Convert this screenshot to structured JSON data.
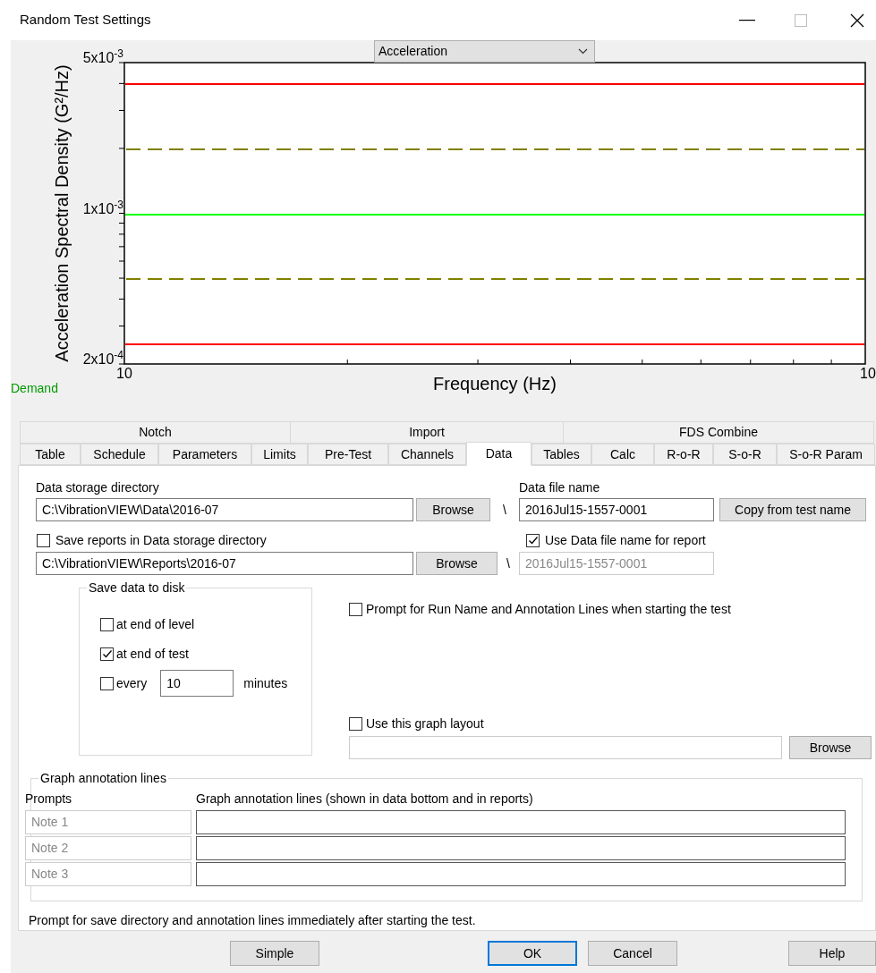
{
  "window": {
    "title": "Random Test Settings"
  },
  "chart": {
    "selector": "Acceleration",
    "ylabel": "Acceleration Spectral Density (G²/Hz)",
    "xlabel": "Frequency (Hz)",
    "y_tick_labels": [
      "5x10$^{-3}$",
      "1x10$^{-3}$",
      "2x10$^{-4}$"
    ],
    "x_tick_labels": [
      "10",
      "10"
    ],
    "lines": [
      {
        "color": "#ff0000",
        "kind": "solid"
      },
      {
        "color": "#808000",
        "kind": "dashed"
      },
      {
        "color": "#00ff00",
        "kind": "solid"
      },
      {
        "color": "#808000",
        "kind": "dashed"
      },
      {
        "color": "#ff0000",
        "kind": "solid"
      }
    ],
    "legend": [
      {
        "label": "Demand"
      }
    ]
  },
  "tab_groups": [
    {
      "label": "Notch"
    },
    {
      "label": "Import"
    },
    {
      "label": "FDS Combine"
    }
  ],
  "tabs": [
    {
      "label": "Table",
      "selected": false
    },
    {
      "label": "Schedule",
      "selected": false
    },
    {
      "label": "Parameters",
      "selected": false
    },
    {
      "label": "Limits",
      "selected": false
    },
    {
      "label": "Pre-Test",
      "selected": false
    },
    {
      "label": "Channels",
      "selected": false
    },
    {
      "label": "Data",
      "selected": true
    },
    {
      "label": "Tables",
      "selected": false
    },
    {
      "label": "Calc",
      "selected": false
    },
    {
      "label": "R-o-R",
      "selected": false
    },
    {
      "label": "S-o-R",
      "selected": false
    },
    {
      "label": "S-o-R Param",
      "selected": false
    }
  ],
  "data_storage": {
    "label": "Data storage directory",
    "value": "C:\\VibrationVIEW\\Data\\2016-07",
    "browse": "Browse",
    "separator": "\\"
  },
  "data_file": {
    "label": "Data file name",
    "value": "2016Jul15-1557-0001",
    "button": "Copy from test name"
  },
  "save_reports": {
    "label": "Save reports in Data storage directory",
    "checked": false,
    "value": "C:\\VibrationVIEW\\Reports\\2016-07",
    "browse": "Browse",
    "separator": "\\"
  },
  "use_file_name": {
    "label": "Use Data file name for report",
    "checked": true,
    "value": "2016Jul15-1557-0001",
    "disabled": true
  },
  "save_to_disk": {
    "title": "Save data to disk",
    "options": [
      {
        "label": "at end of level",
        "checked": false
      },
      {
        "label": "at end of test",
        "checked": true
      },
      {
        "label": "every",
        "checked": false,
        "value": "10",
        "unit": "minutes"
      }
    ]
  },
  "prompt_run_name": {
    "label": "Prompt for Run Name and Annotation Lines when starting the test",
    "checked": false
  },
  "graph_layout": {
    "label": "Use this graph layout",
    "checked": false,
    "browse": "Browse"
  },
  "annotations": {
    "title": "Graph annotation lines",
    "prompts_header": "Prompts",
    "lines_header": "Graph annotation lines (shown in data bottom and in reports)",
    "rows": [
      {
        "prompt": "Note 1"
      },
      {
        "prompt": "Note 2"
      },
      {
        "prompt": "Note 3"
      }
    ]
  },
  "footer_note": "Prompt for save directory and annotation lines immediately after starting the test.",
  "buttons": [
    {
      "label": "Simple",
      "focused": false
    },
    {
      "label": "OK",
      "focused": true
    },
    {
      "label": "Cancel",
      "focused": false
    },
    {
      "label": "Help",
      "focused": false
    }
  ]
}
